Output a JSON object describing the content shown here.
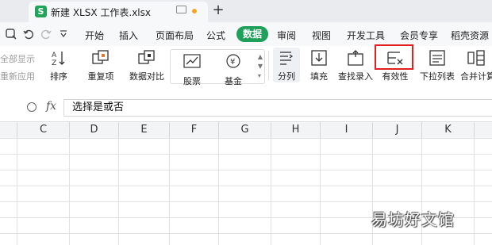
{
  "tabbar": {
    "doc_title": "新建 XLSX 工作表.xlsx",
    "doc_icon": "S",
    "add_tab": "+"
  },
  "menu": {
    "items": [
      "开始",
      "插入",
      "页面布局",
      "公式",
      "数据",
      "审阅",
      "视图",
      "开发工具",
      "会员专享",
      "稻壳资源"
    ],
    "active": "数据"
  },
  "ribbon": {
    "left_top": "全部显示",
    "left_bottom": "重新应用",
    "tools": [
      "排序",
      "重复项",
      "数据对比",
      "分列",
      "填充",
      "查找录入",
      "有效性",
      "下拉列表",
      "合并计算"
    ],
    "gallery": [
      "股票",
      "基金"
    ]
  },
  "formula": {
    "fx": "fx",
    "value": "选择是或否"
  },
  "columns": [
    "C",
    "D",
    "E",
    "F",
    "G",
    "H",
    "I",
    "J",
    "K"
  ],
  "watermark": "易坊好文馆",
  "colors": {
    "accent": "#1fa05a",
    "highlight": "#e02020"
  }
}
